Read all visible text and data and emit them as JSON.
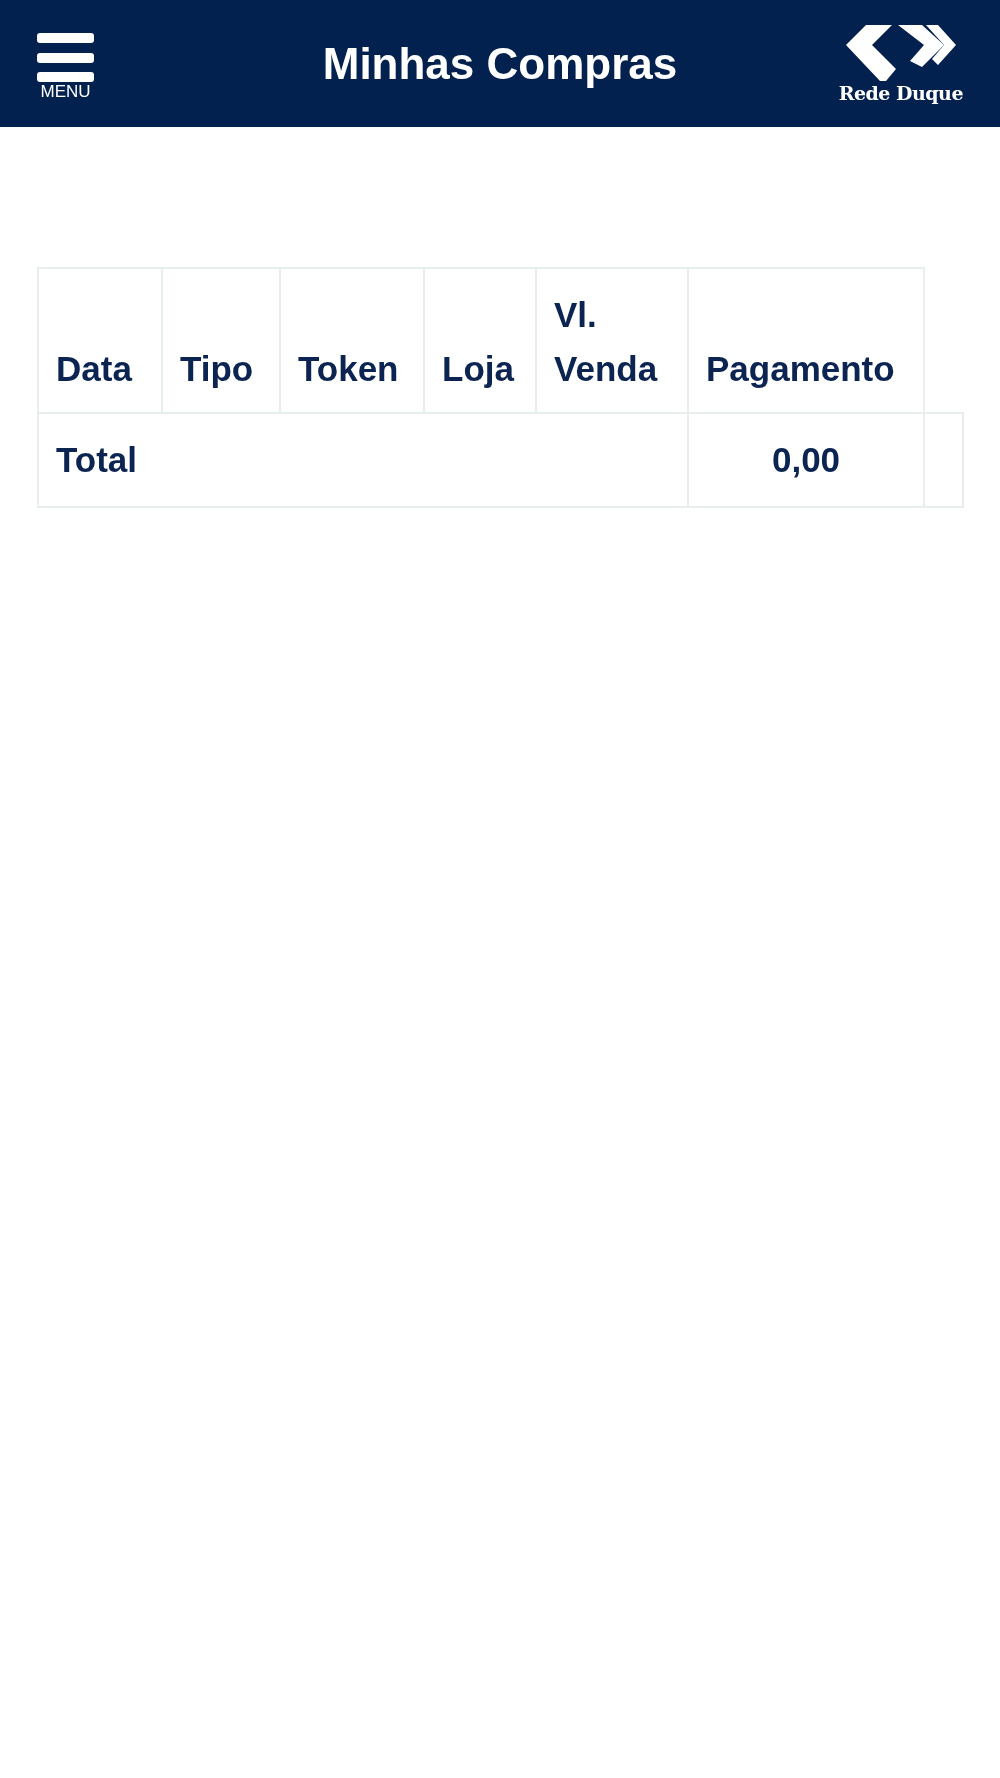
{
  "header": {
    "menu_label": "MENU",
    "title": "Minhas Compras",
    "logo_text": "Rede Duque"
  },
  "table": {
    "columns": [
      "Data",
      "Tipo",
      "Token",
      "Loja",
      "Vl. Venda",
      "Pagamento"
    ],
    "total_row": {
      "label": "Total",
      "value": "0,00"
    }
  }
}
